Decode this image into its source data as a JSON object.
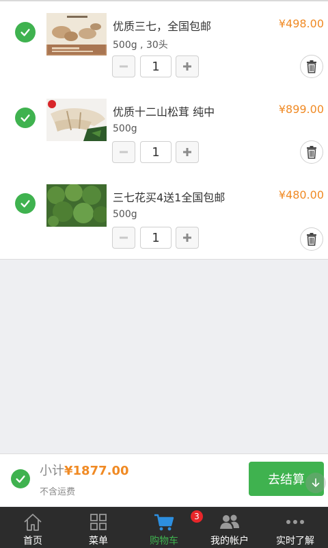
{
  "cart": {
    "items": [
      {
        "title": "优质三七，全国包邮",
        "spec": "500g , 30头",
        "price": "¥498.00",
        "quantity": "1"
      },
      {
        "title": "优质十二山松茸 纯中",
        "spec": "500g",
        "price": "¥899.00",
        "quantity": "1"
      },
      {
        "title": "三七花买4送1全国包邮",
        "spec": "500g",
        "price": "¥480.00",
        "quantity": "1"
      }
    ]
  },
  "footer": {
    "subtotal_label": "小计",
    "subtotal_amount": "¥1877.00",
    "shipping_note": "不含运费",
    "checkout_label": "去结算"
  },
  "tabbar": {
    "tabs": [
      {
        "label": "首页",
        "icon": "home-icon"
      },
      {
        "label": "菜单",
        "icon": "menu-grid-icon"
      },
      {
        "label": "购物车",
        "icon": "cart-icon",
        "badge": "3",
        "active": true
      },
      {
        "label": "我的帐户",
        "icon": "users-icon"
      },
      {
        "label": "实时了解",
        "icon": "more-dots-icon"
      }
    ]
  },
  "colors": {
    "accent_green": "#3fb24f",
    "price_orange": "#f08a24",
    "tabbar_bg": "#2c2c2c",
    "badge_red": "#e8262a"
  }
}
